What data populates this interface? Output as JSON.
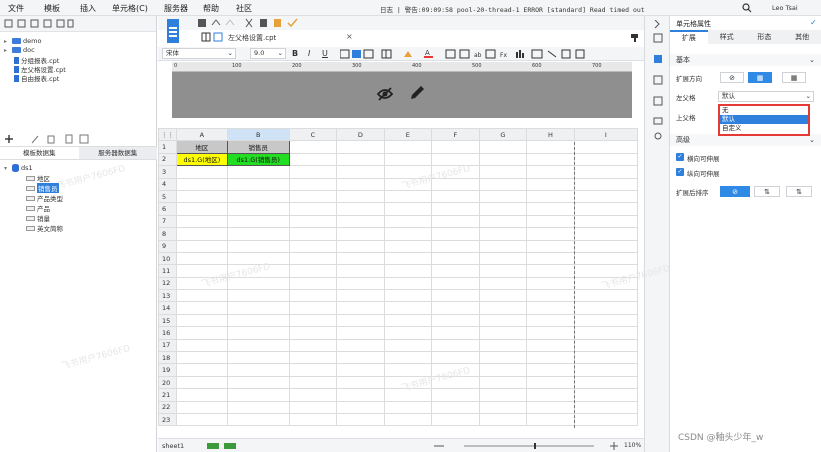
{
  "menubar": {
    "items": [
      "文件",
      "模板",
      "插入",
      "单元格(C)",
      "服务器",
      "帮助",
      "社区"
    ],
    "log_text": "日志 | 警告:09:09:58 pool-20-thread-1 ERROR [standard] Read timed out",
    "user_name": "Leo Tsai"
  },
  "left_panel": {
    "tree": [
      {
        "label": "demo",
        "type": "folder"
      },
      {
        "label": "doc",
        "type": "folder"
      },
      {
        "label": "分组报表.cpt",
        "type": "file"
      },
      {
        "label": "左父格设置.cpt",
        "type": "file"
      },
      {
        "label": "自由报表.cpt",
        "type": "file"
      }
    ],
    "tabs": [
      "模板数据集",
      "服务器数据集"
    ],
    "dataset": {
      "name": "ds1",
      "fields": [
        "地区",
        "销售员",
        "产品类型",
        "产品",
        "销量",
        "英文简称"
      ],
      "selected_field": "销售员"
    }
  },
  "editor": {
    "file_tab": "左父格设置.cpt",
    "font_name": "宋体",
    "font_size": "9.0",
    "ruler_ticks": [
      "0",
      "100",
      "200",
      "300",
      "400",
      "500",
      "600",
      "700"
    ],
    "columns": [
      "A",
      "B",
      "C",
      "D",
      "E",
      "F",
      "G",
      "H",
      "I"
    ],
    "selected_column": "B",
    "rows": [
      "1",
      "2",
      "3",
      "4",
      "5",
      "6",
      "7",
      "8",
      "9",
      "10",
      "11",
      "12",
      "13",
      "14",
      "15",
      "16",
      "17",
      "18",
      "19",
      "20",
      "21",
      "22",
      "23"
    ],
    "cells": {
      "A1": "地区",
      "B1": "销售员",
      "A2": "ds1.G(地区)",
      "B2": "ds1.G(销售员)"
    },
    "sheet_tab": "sheet1",
    "zoom": "110%"
  },
  "right_panel": {
    "title": "单元格属性",
    "tabs": [
      "扩展",
      "样式",
      "形态",
      "其他"
    ],
    "active_tab": "扩展",
    "section_basic": "基本",
    "expand_direction_label": "扩展方向",
    "left_parent_label": "左父格",
    "left_parent_value": "默认",
    "top_parent_label": "上父格",
    "dropdown_options": [
      "无",
      "默认",
      "自定义"
    ],
    "dropdown_selected": "默认",
    "section_advanced": "高级",
    "horizontal_expand": "横向可伸展",
    "vertical_expand": "纵向可伸展",
    "sort_label": "扩展后排序"
  },
  "watermark_text": "飞书用户7606FD",
  "credit_text": "CSDN @釉头少年_w",
  "colors": {
    "accent": "#2f7fdd",
    "highlight_border": "#e53935",
    "yellow_cell": "#ffff00",
    "green_cell": "#22dd22"
  }
}
